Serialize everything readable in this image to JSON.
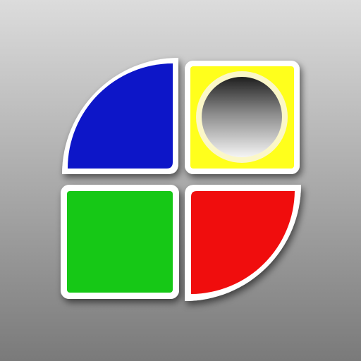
{
  "icon": {
    "name": "four-quadrant-app-icon",
    "background": {
      "top_color": "#dcdcdc",
      "bottom_color": "#7a7a7a"
    },
    "tiles": [
      {
        "name": "blue-quarter-circle-tile",
        "shape": "quarter-circle",
        "fill": "#0a14c8"
      },
      {
        "name": "yellow-tile-with-ring",
        "shape": "square-with-ring",
        "fill": "#ffff1e"
      },
      {
        "name": "green-square-tile",
        "shape": "square",
        "fill": "#14c814"
      },
      {
        "name": "red-quarter-circle-tile",
        "shape": "quarter-circle",
        "fill": "#f01010"
      }
    ],
    "border_color": "#ffffff",
    "ring": {
      "outer_color": "#fbf7c8",
      "inner_top_color": "#1f1f1f",
      "inner_bottom_color": "#f5f5f5"
    }
  }
}
